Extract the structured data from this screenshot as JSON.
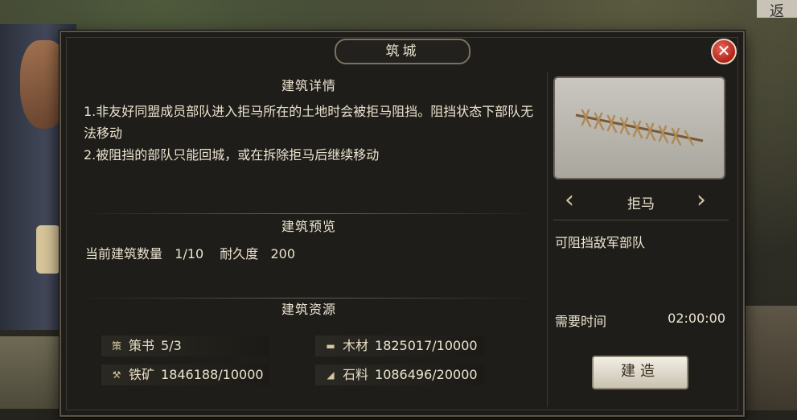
{
  "corner_tag": "返",
  "dialog": {
    "title": "筑城"
  },
  "details": {
    "section_title": "建筑详情",
    "lines": [
      "1.非友好同盟成员部队进入拒马所在的土地时会被拒马阻挡。阻挡状态下部队无法移动",
      "2.被阻挡的部队只能回城，或在拆除拒马后继续移动"
    ]
  },
  "preview": {
    "section_title": "建筑预览",
    "count_label": "当前建筑数量",
    "count_value": "1/10",
    "durability_label": "耐久度",
    "durability_value": "200"
  },
  "resources": {
    "section_title": "建筑资源",
    "items": [
      {
        "icon": "strategy-book-icon",
        "glyph": "策",
        "label": "策书",
        "value": "5/3"
      },
      {
        "icon": "wood-icon",
        "glyph": "▬",
        "label": "木材",
        "value": "1825017/10000"
      },
      {
        "icon": "iron-ore-icon",
        "glyph": "⚒",
        "label": "铁矿",
        "value": "1846188/10000"
      },
      {
        "icon": "stone-icon",
        "glyph": "◢",
        "label": "石料",
        "value": "1086496/20000"
      }
    ]
  },
  "building": {
    "name": "拒马",
    "description": "可阻挡敌军部队",
    "time_label": "需要时间",
    "time_value": "02:00:00",
    "build_button": "建造"
  },
  "colors": {
    "panel_bg": "#1f1d19",
    "close_red": "#b2231a",
    "text": "#ece4d0",
    "button_face": "#e8e3d6"
  }
}
